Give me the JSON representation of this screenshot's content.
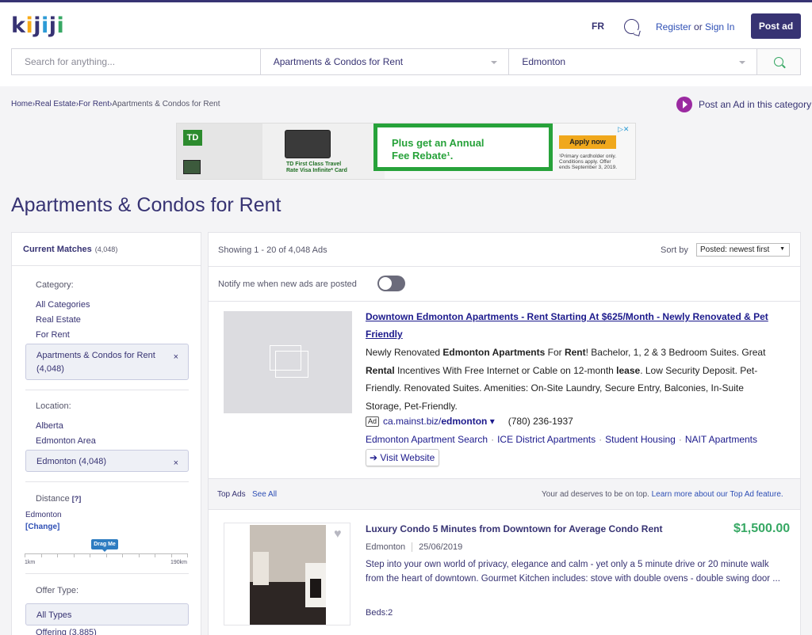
{
  "header": {
    "logo": "kijiji",
    "logo_letter_colors": [
      "#373373",
      "#f8aa17",
      "#373373",
      "#2e9bd6",
      "#373373",
      "#37a864"
    ],
    "lang_toggle": "FR",
    "chat_icon": "chat-icon",
    "register": "Register",
    "or": "or",
    "sign_in": "Sign In",
    "post_ad": "Post ad"
  },
  "search": {
    "placeholder": "Search for anything...",
    "category": "Apartments & Condos for Rent",
    "location": "Edmonton",
    "search_icon": "search-icon"
  },
  "breadcrumb": {
    "items": [
      "Home",
      "Real Estate",
      "For Rent"
    ],
    "current": "Apartments & Condos for Rent",
    "separator": "›"
  },
  "post_in_category": "Post an Ad in this category",
  "banner_ad": {
    "brand": "TD",
    "card_text_1": "TD First Class Travel",
    "card_text_2": "Rate Visa Infinite* Card",
    "headline_1": "Plus get an Annual",
    "headline_2": "Fee Rebate¹.",
    "apply": "Apply now",
    "fine_1": "¹Primary cardholder only.",
    "fine_2": "Conditions apply. Offer",
    "fine_3": "ends September 3, 2019.",
    "adchoices": "▷✕"
  },
  "page_title": "Apartments & Condos for Rent",
  "filters": {
    "current_matches": "Current Matches",
    "current_matches_count": "(4,048)",
    "category_label": "Category:",
    "category_items": [
      "All Categories",
      "Real Estate",
      "For Rent"
    ],
    "category_selected": "Apartments & Condos for Rent",
    "category_selected_count": "(4,048)",
    "location_label": "Location:",
    "location_items": [
      "Alberta",
      "Edmonton Area"
    ],
    "location_selected": "Edmonton (4,048)",
    "distance_label": "Distance",
    "distance_help": "[?]",
    "distance_city": "Edmonton",
    "distance_change": "[Change]",
    "drag_me": "Drag Me",
    "slider_min": "1km",
    "slider_max": "190km",
    "offer_label": "Offer Type:",
    "offer_selected": "All Types",
    "offer_item": "Offering (3,885)",
    "remove": "×"
  },
  "results": {
    "showing": "Showing 1 - 20 of 4,048 Ads",
    "sort_by": "Sort by",
    "sort_value": "Posted: newest first",
    "notify": "Notify me when new ads are posted",
    "notify_on": false
  },
  "sponsored": {
    "title": "Downtown Edmonton Apartments - Rent Starting At $625/Month - Newly Renovated & Pet Friendly",
    "desc_parts": [
      {
        "t": "Newly Renovated ",
        "b": false
      },
      {
        "t": "Edmonton Apartments",
        "b": true
      },
      {
        "t": " For ",
        "b": false
      },
      {
        "t": "Rent",
        "b": true
      },
      {
        "t": "! Bachelor, 1, 2 & 3 Bedroom Suites. Great ",
        "b": false
      },
      {
        "t": "Rental",
        "b": true
      },
      {
        "t": " Incentives With Free Internet or Cable on 12-month ",
        "b": false
      },
      {
        "t": "lease",
        "b": true
      },
      {
        "t": ". Low Security Deposit. Pet-Friendly. Renovated Suites. Amenities: On-Site Laundry, Secure Entry, Balconies, In-Suite Storage, Pet-Friendly.",
        "b": false
      }
    ],
    "ad_tag": "Ad",
    "url_prefix": "ca.mainst.biz/",
    "url_bold": "edmonton",
    "url_caret": "▾",
    "phone": "(780) 236-1937",
    "links": [
      "Edmonton Apartment Search",
      "ICE District Apartments",
      "Student Housing",
      "NAIT Apartments"
    ],
    "link_sep": "·",
    "visit": "➔ Visit Website"
  },
  "top_ads": {
    "label": "Top Ads",
    "see_all": "See All",
    "promo": "Your ad deserves to be on top.",
    "learn_more": "Learn more about our Top Ad feature."
  },
  "listing": {
    "title": "Luxury Condo 5 Minutes from Downtown for Average Condo Rent",
    "price": "$1,500.00",
    "location": "Edmonton",
    "date": "25/06/2019",
    "description": "Step into your own world of privacy, elegance and calm - yet only a 5 minute drive or 20 minute walk from the heart of downtown. Gourmet Kitchen includes: stove with double ovens - double swing door ...",
    "beds": "Beds:2",
    "heart_icon": "heart-icon"
  }
}
